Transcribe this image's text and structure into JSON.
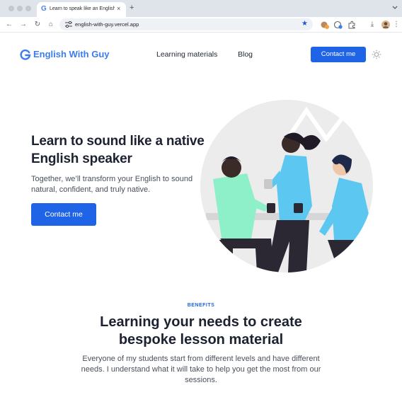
{
  "browser": {
    "tab_title": "Learn to speak like an English",
    "favicon_glyph": "G",
    "close_glyph": "×",
    "new_tab_glyph": "+",
    "url": "english-with-guy.vercel.app",
    "back_glyph": "←",
    "forward_glyph": "→",
    "reload_glyph": "↻",
    "home_glyph": "⌂",
    "star_glyph": "★",
    "download_glyph": "⤓",
    "menu_glyph": "⋮"
  },
  "site": {
    "logo_text": "English With Guy",
    "nav": [
      {
        "label": "Learning materials"
      },
      {
        "label": "Blog"
      }
    ],
    "header_cta": "Contact me"
  },
  "hero": {
    "title": "Learn to sound like a native English speaker",
    "subtitle": "Together, we’ll transform your English to sound natural, confident, and truly native.",
    "cta": "Contact me"
  },
  "benefits": {
    "eyebrow": "BENEFITS",
    "title_line1": "Learning your needs to create",
    "title_line2": "bespoke lesson material",
    "text": "Everyone of my students start from different levels and have different needs. I understand what it will take to help you get the most from our sessions."
  },
  "colors": {
    "accent": "#1f63e6",
    "logo": "#3b7cf0",
    "illustration_bg": "#ececed",
    "shirt_mint": "#8ef0c8",
    "shirt_blue": "#5cc8f2",
    "dark": "#2b2733"
  }
}
